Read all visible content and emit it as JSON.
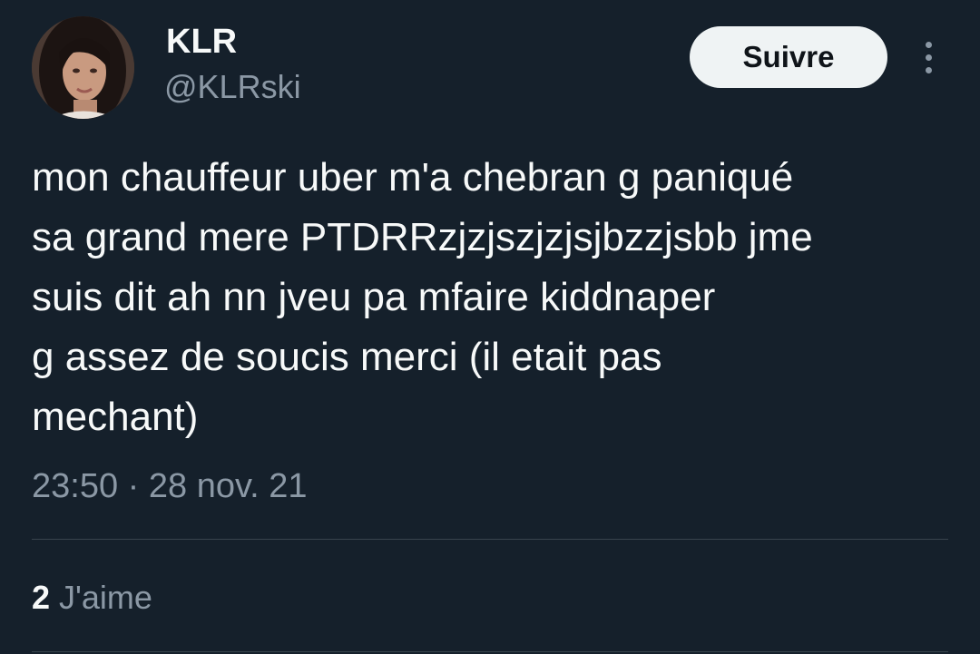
{
  "author": {
    "display_name": "KLR",
    "handle": "@KLRski"
  },
  "follow_button": {
    "label": "Suivre"
  },
  "more_button": {
    "icon": "more-vertical-icon"
  },
  "tweet": {
    "text": "mon chauffeur uber m'a chebran g paniqué\nsa grand mere PTDRRzjzjszjzjsjbzzjsbb jme\nsuis dit ah nn jveu pa mfaire kiddnaper\ng assez de soucis merci (il etait pas\nmechant)",
    "time": "23:50",
    "separator": " · ",
    "date": "28 nov. 21"
  },
  "stats": {
    "likes_count": "2",
    "likes_label": " J'aime"
  },
  "colors": {
    "background": "#15202b",
    "text_primary": "#f7f9f9",
    "text_secondary": "#8b98a5",
    "button_bg": "#eff3f4",
    "divider": "#38444d"
  }
}
